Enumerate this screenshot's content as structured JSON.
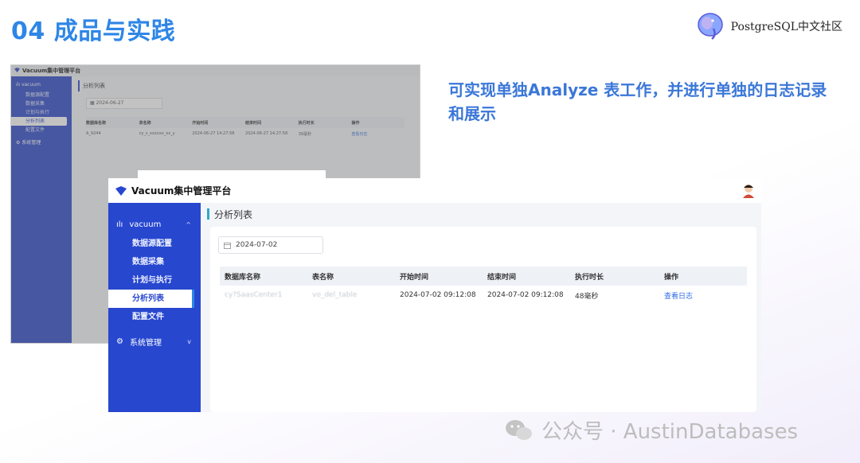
{
  "slide": {
    "title": "04 成品与实践",
    "brand": "PostgreSQL中文社区",
    "description": "可实现单独Analyze 表工作，并进行单独的日志记录和展示",
    "watermark": "公众号 · AustinDatabases"
  },
  "back_screenshot": {
    "app_title": "Vacuum集中管理平台",
    "sidebar": {
      "group1": "vacuum",
      "items": [
        "数据源配置",
        "数据采集",
        "计划与执行",
        "分析列表",
        "配置文件"
      ],
      "selected": "分析列表",
      "group2": "系统管理"
    },
    "page_header": "分析列表",
    "date": "2024-06-27",
    "table": {
      "columns": [
        "数据库名称",
        "表名称",
        "开始时间",
        "结束时间",
        "执行时长",
        "操作"
      ],
      "rows": [
        [
          "A_9244",
          "cy_s_xxxxxx_xx_y",
          "2024-06-27 14:27:58",
          "2024-06-27 14:27:58",
          "39毫秒",
          "查看日志"
        ]
      ]
    }
  },
  "front_screenshot": {
    "app_title": "Vacuum集中管理平台",
    "sidebar": {
      "group1": "vacuum",
      "items": [
        "数据源配置",
        "数据采集",
        "计划与执行",
        "分析列表",
        "配置文件"
      ],
      "selected": "分析列表",
      "group2": "系统管理"
    },
    "page_header": "分析列表",
    "date": "2024-07-02",
    "table": {
      "columns": [
        "数据库名称",
        "表名称",
        "开始时间",
        "结束时间",
        "执行时长",
        "操作"
      ],
      "rows": [
        [
          "cy?SaasCenter1",
          "vo_del_table",
          "2024-07-02 09:12:08",
          "2024-07-02 09:12:08",
          "48毫秒",
          "查看日志"
        ]
      ]
    }
  },
  "colors": {
    "title_blue": "#2e86e6",
    "sidebar_blue": "#2747cf",
    "link_blue": "#2e6be6",
    "description_blue": "#3b77d8"
  }
}
